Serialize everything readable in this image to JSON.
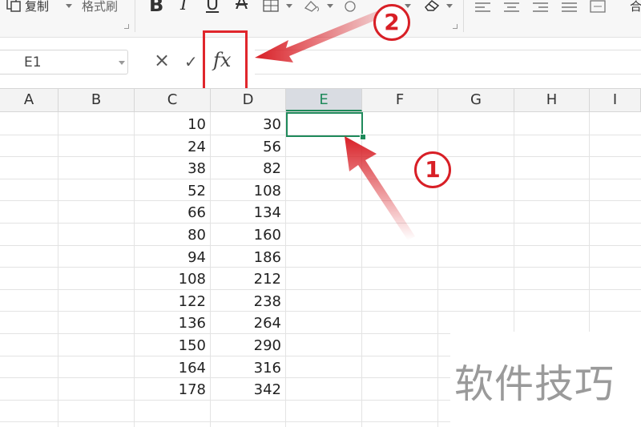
{
  "toolbar": {
    "copy_label": "复制",
    "format_painter_label": "格式刷",
    "bold_glyph": "B",
    "italic_glyph": "I",
    "underline_glyph": "U",
    "strike_glyph": "A",
    "merge_partial": "合"
  },
  "formula_bar": {
    "name_box": "E1",
    "cancel_glyph": "×",
    "confirm_glyph": "✓",
    "fx_label": "fx",
    "value": ""
  },
  "columns": [
    "A",
    "B",
    "C",
    "D",
    "E",
    "F",
    "G",
    "H",
    "I"
  ],
  "selected_column": "E",
  "rows": [
    {
      "c": "10",
      "d": "30"
    },
    {
      "c": "24",
      "d": "56"
    },
    {
      "c": "38",
      "d": "82"
    },
    {
      "c": "52",
      "d": "108"
    },
    {
      "c": "66",
      "d": "134"
    },
    {
      "c": "80",
      "d": "160"
    },
    {
      "c": "94",
      "d": "186"
    },
    {
      "c": "108",
      "d": "212"
    },
    {
      "c": "122",
      "d": "238"
    },
    {
      "c": "136",
      "d": "264"
    },
    {
      "c": "150",
      "d": "290"
    },
    {
      "c": "164",
      "d": "316"
    },
    {
      "c": "178",
      "d": "342"
    }
  ],
  "annotations": {
    "step1": "1",
    "step2": "2",
    "highlight_color": "#e0262c"
  },
  "watermark": "软件技巧",
  "colors": {
    "accent_green": "#1f8a5b",
    "annotation_red": "#d81f26"
  }
}
